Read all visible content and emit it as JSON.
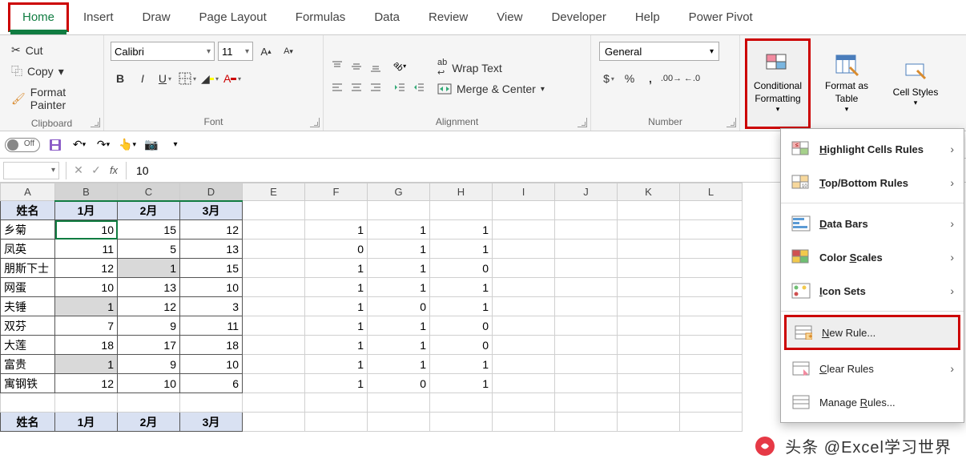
{
  "tabs": {
    "home": "Home",
    "insert": "Insert",
    "draw": "Draw",
    "page": "Page Layout",
    "formulas": "Formulas",
    "data": "Data",
    "review": "Review",
    "view": "View",
    "dev": "Developer",
    "help": "Help",
    "pp": "Power Pivot"
  },
  "clipboard": {
    "cut": "Cut",
    "copy": "Copy",
    "painter": "Format Painter",
    "label": "Clipboard"
  },
  "font": {
    "name": "Calibri",
    "size": "11",
    "label": "Font"
  },
  "alignment": {
    "wrap": "Wrap Text",
    "merge": "Merge & Center",
    "label": "Alignment"
  },
  "number": {
    "format": "General",
    "label": "Number"
  },
  "styles": {
    "cond": "Conditional Formatting",
    "table": "Format as Table",
    "cell": "Cell Styles"
  },
  "qat": {
    "off": "Off"
  },
  "formula_bar": {
    "value": "10"
  },
  "cf_menu": {
    "highlight": "Highlight Cells Rules",
    "topbottom": "Top/Bottom Rules",
    "databars": "Data Bars",
    "colorscales": "Color Scales",
    "iconsets": "Icon Sets",
    "newrule": "New Rule...",
    "clear": "Clear Rules",
    "manage": "Manage Rules..."
  },
  "cols": [
    "A",
    "B",
    "C",
    "D",
    "E",
    "F",
    "G",
    "H",
    "I",
    "J",
    "K",
    "L"
  ],
  "headers": {
    "name": "姓名",
    "m1": "1月",
    "m2": "2月",
    "m3": "3月"
  },
  "rows": [
    {
      "a": "乡菊",
      "b": 10,
      "c": 15,
      "d": 12,
      "f": 1,
      "g": 1,
      "h": 1
    },
    {
      "a": "凤英",
      "b": 11,
      "c": 5,
      "d": 13,
      "f": 0,
      "g": 1,
      "h": 1
    },
    {
      "a": "朋斯下士",
      "b": 12,
      "c": 1,
      "d": 15,
      "f": 1,
      "g": 1,
      "h": 0,
      "shade": [
        "c"
      ]
    },
    {
      "a": "网蛋",
      "b": 10,
      "c": 13,
      "d": 10,
      "f": 1,
      "g": 1,
      "h": 1
    },
    {
      "a": "夫锤",
      "b": 1,
      "c": 12,
      "d": 3,
      "f": 1,
      "g": 0,
      "h": 1,
      "shade": [
        "b"
      ]
    },
    {
      "a": "双芬",
      "b": 7,
      "c": 9,
      "d": 11,
      "f": 1,
      "g": 1,
      "h": 0
    },
    {
      "a": "大莲",
      "b": 18,
      "c": 17,
      "d": 18,
      "f": 1,
      "g": 1,
      "h": 0
    },
    {
      "a": "富贵",
      "b": 1,
      "c": 9,
      "d": 10,
      "f": 1,
      "g": 1,
      "h": 1,
      "shade": [
        "b"
      ]
    },
    {
      "a": "寓钢铁",
      "b": 12,
      "c": 10,
      "d": 6,
      "f": 1,
      "g": 0,
      "h": 1
    }
  ],
  "watermark": "头条 @Excel学习世界"
}
